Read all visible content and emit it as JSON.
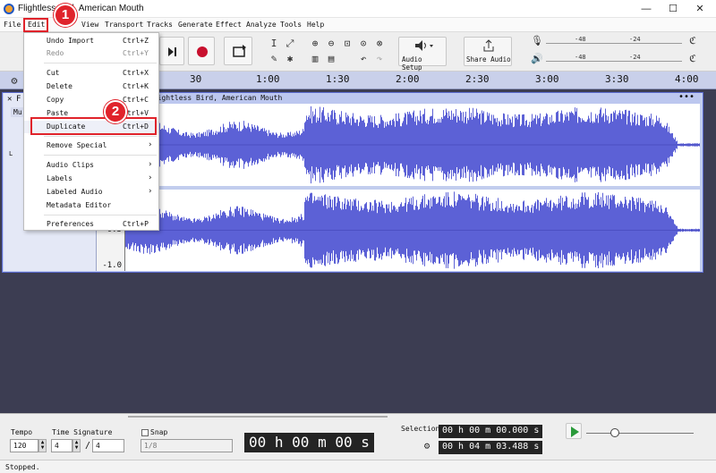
{
  "window": {
    "title": "Flightless Bird, American Mouth",
    "minimize": "—",
    "maximize": "☐",
    "close": "✕"
  },
  "menubar": [
    {
      "label": "File"
    },
    {
      "label": "Edit"
    },
    {
      "label": "View"
    },
    {
      "label": "Transport"
    },
    {
      "label": "Tracks"
    },
    {
      "label": "Generate"
    },
    {
      "label": "Effect"
    },
    {
      "label": "Analyze"
    },
    {
      "label": "Tools"
    },
    {
      "label": "Help"
    }
  ],
  "toolbar": {
    "audio_setup_label": "Audio Setup",
    "share_audio_label": "Share Audio",
    "meter_ticks": [
      "-48",
      "-24",
      "-48",
      "-24"
    ]
  },
  "ruler": {
    "ticks": [
      "30",
      "1:00",
      "1:30",
      "2:00",
      "2:30",
      "3:00",
      "3:30",
      "4:00"
    ]
  },
  "track": {
    "clip_name": "Flightless Bird, American Mouth",
    "scale_labels": [
      "-0.5",
      "-1.0"
    ],
    "control_labels": {
      "close": "✕",
      "mute": "Mu",
      "left": "L"
    }
  },
  "edit_menu": {
    "items": [
      {
        "label": "Undo Import",
        "shortcut": "Ctrl+Z",
        "disabled": false
      },
      {
        "label": "Redo",
        "shortcut": "Ctrl+Y",
        "disabled": true
      },
      {
        "label": "Cut",
        "shortcut": "Ctrl+X",
        "disabled": false
      },
      {
        "label": "Delete",
        "shortcut": "Ctrl+K",
        "disabled": false
      },
      {
        "label": "Copy",
        "shortcut": "Ctrl+C",
        "disabled": false
      },
      {
        "label": "Paste",
        "shortcut": "Ctrl+V",
        "disabled": false
      },
      {
        "label": "Duplicate",
        "shortcut": "Ctrl+D",
        "disabled": false
      },
      {
        "label": "Remove Special",
        "shortcut": "",
        "submenu": true
      },
      {
        "label": "Audio Clips",
        "shortcut": "",
        "submenu": true
      },
      {
        "label": "Labels",
        "shortcut": "",
        "submenu": true
      },
      {
        "label": "Labeled Audio",
        "shortcut": "",
        "submenu": true
      },
      {
        "label": "Metadata Editor",
        "shortcut": ""
      },
      {
        "label": "Preferences",
        "shortcut": "Ctrl+P"
      }
    ]
  },
  "annotations": {
    "step1": "1",
    "step2": "2"
  },
  "bottom": {
    "tempo_label": "Tempo",
    "tempo_value": "120",
    "time_signature_label": "Time Signature",
    "ts_numerator": "4",
    "ts_slash": "/",
    "ts_denominator": "4",
    "snap_label": "Snap",
    "snap_value": "1/8",
    "time_display": "00 h 00 m 00 s",
    "selection_label": "Selection",
    "selection_start": "00 h 00 m 00.000 s",
    "selection_end": "00 h 04 m 03.488 s"
  },
  "status": {
    "text": "Stopped."
  },
  "colors": {
    "waveform": "#5c61d6",
    "accent_red": "#e0232b",
    "ruler": "#c9d0ea"
  }
}
